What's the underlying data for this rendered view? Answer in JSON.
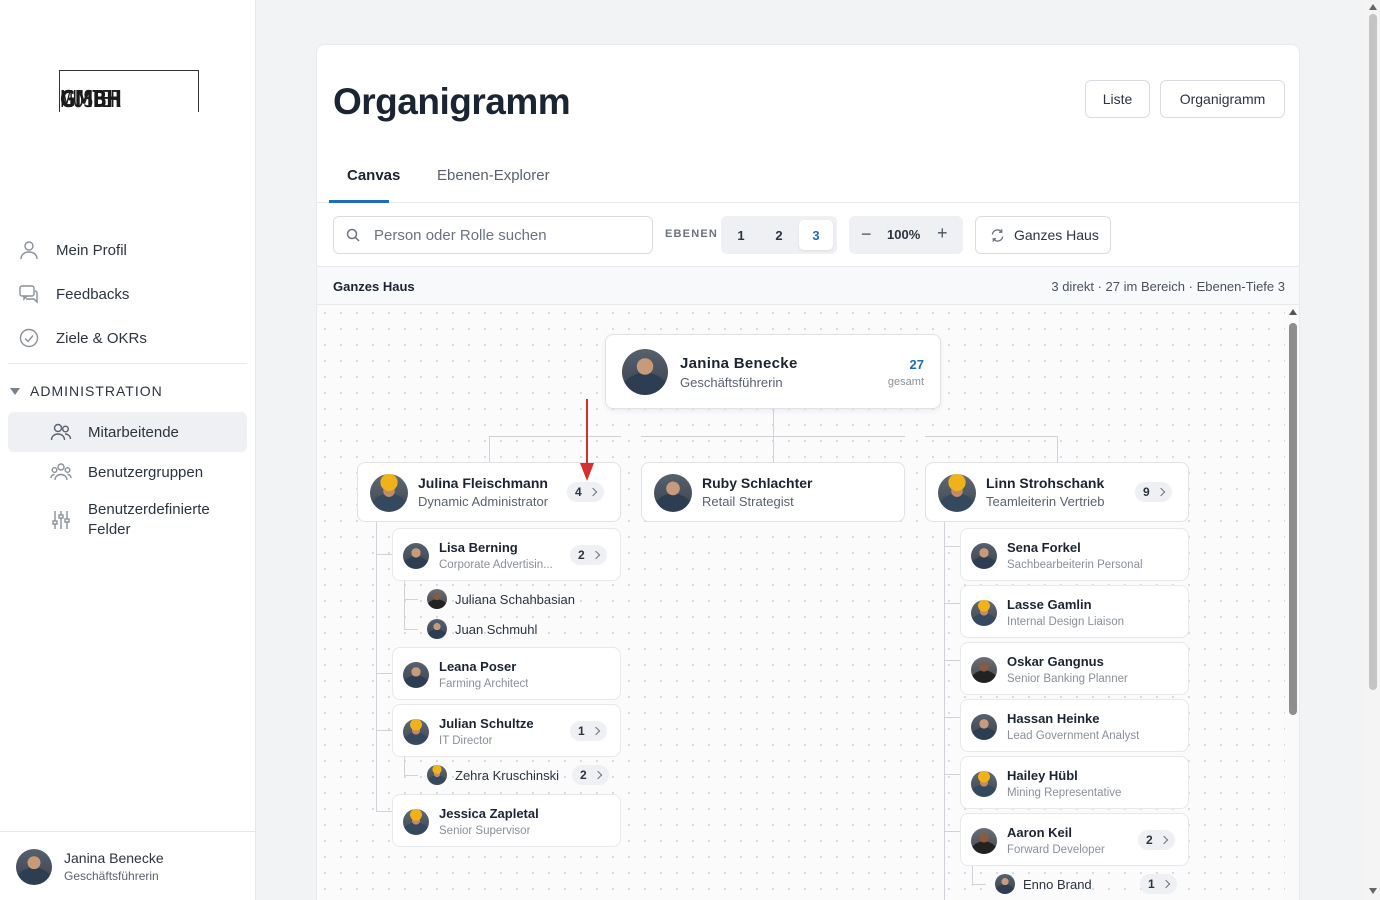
{
  "app": {
    "logo_light": "MUSTER",
    "logo_bold": "GMBH"
  },
  "sidebar": {
    "items": [
      {
        "label": "Mein Profil"
      },
      {
        "label": "Feedbacks"
      },
      {
        "label": "Ziele & OKRs"
      }
    ],
    "section": "ADMINISTRATION",
    "admin_items": [
      {
        "label": "Mitarbeitende"
      },
      {
        "label": "Benutzergruppen"
      },
      {
        "label": "Benutzerdefinierte Felder"
      }
    ],
    "user": {
      "name": "Janina Benecke",
      "role": "Geschäftsführerin"
    }
  },
  "header": {
    "title": "Organigramm",
    "btn_list": "Liste",
    "btn_org": "Organigramm"
  },
  "tabs": [
    {
      "label": "Canvas"
    },
    {
      "label": "Ebenen-Explorer"
    }
  ],
  "toolbar": {
    "search_placeholder": "Person oder Rolle suchen",
    "levels_label": "EBENEN",
    "levels": [
      "1",
      "2",
      "3"
    ],
    "level_selected": "3",
    "zoom": "100%",
    "scope_button": "Ganzes Haus"
  },
  "info": {
    "scope": "Ganzes Haus",
    "stats": "3 direkt · 27 im Bereich · Ebenen-Tiefe 3"
  },
  "org": {
    "root": {
      "name": "Janina Benecke",
      "role": "Geschäftsführerin",
      "count": "27",
      "count_label": "gesamt"
    },
    "level1": [
      {
        "name": "Julina Fleischmann",
        "role": "Dynamic Administrator",
        "count": "4"
      },
      {
        "name": "Ruby Schlachter",
        "role": "Retail Strategist"
      },
      {
        "name": "Linn Strohschank",
        "role": "Teamleiterin Vertrieb",
        "count": "9"
      }
    ],
    "col1": [
      {
        "name": "Lisa Berning",
        "role": "Corporate Advertisin...",
        "count": "2"
      },
      {
        "name": "Leana Poser",
        "role": "Farming Architect"
      },
      {
        "name": "Julian Schultze",
        "role": "IT Director",
        "count": "1"
      },
      {
        "name": "Jessica Zapletal",
        "role": "Senior Supervisor"
      }
    ],
    "col1_leaves": [
      {
        "name": "Juliana Schahbasian"
      },
      {
        "name": "Juan Schmuhl"
      },
      {
        "name": "Zehra Kruschinski",
        "count": "2"
      }
    ],
    "col3": [
      {
        "name": "Sena Forkel",
        "role": "Sachbearbeiterin Personal"
      },
      {
        "name": "Lasse Gamlin",
        "role": "Internal Design Liaison"
      },
      {
        "name": "Oskar Gangnus",
        "role": "Senior Banking Planner"
      },
      {
        "name": "Hassan Heinke",
        "role": "Lead Government Analyst"
      },
      {
        "name": "Hailey Hübl",
        "role": "Mining Representative"
      },
      {
        "name": "Aaron Keil",
        "role": "Forward Developer",
        "count": "2"
      }
    ],
    "col3_leaves": [
      {
        "name": "Enno Brand",
        "count": "1"
      }
    ]
  },
  "colors": {
    "accent": "#1f6fb0",
    "annotation_arrow": "#d32f2f"
  }
}
